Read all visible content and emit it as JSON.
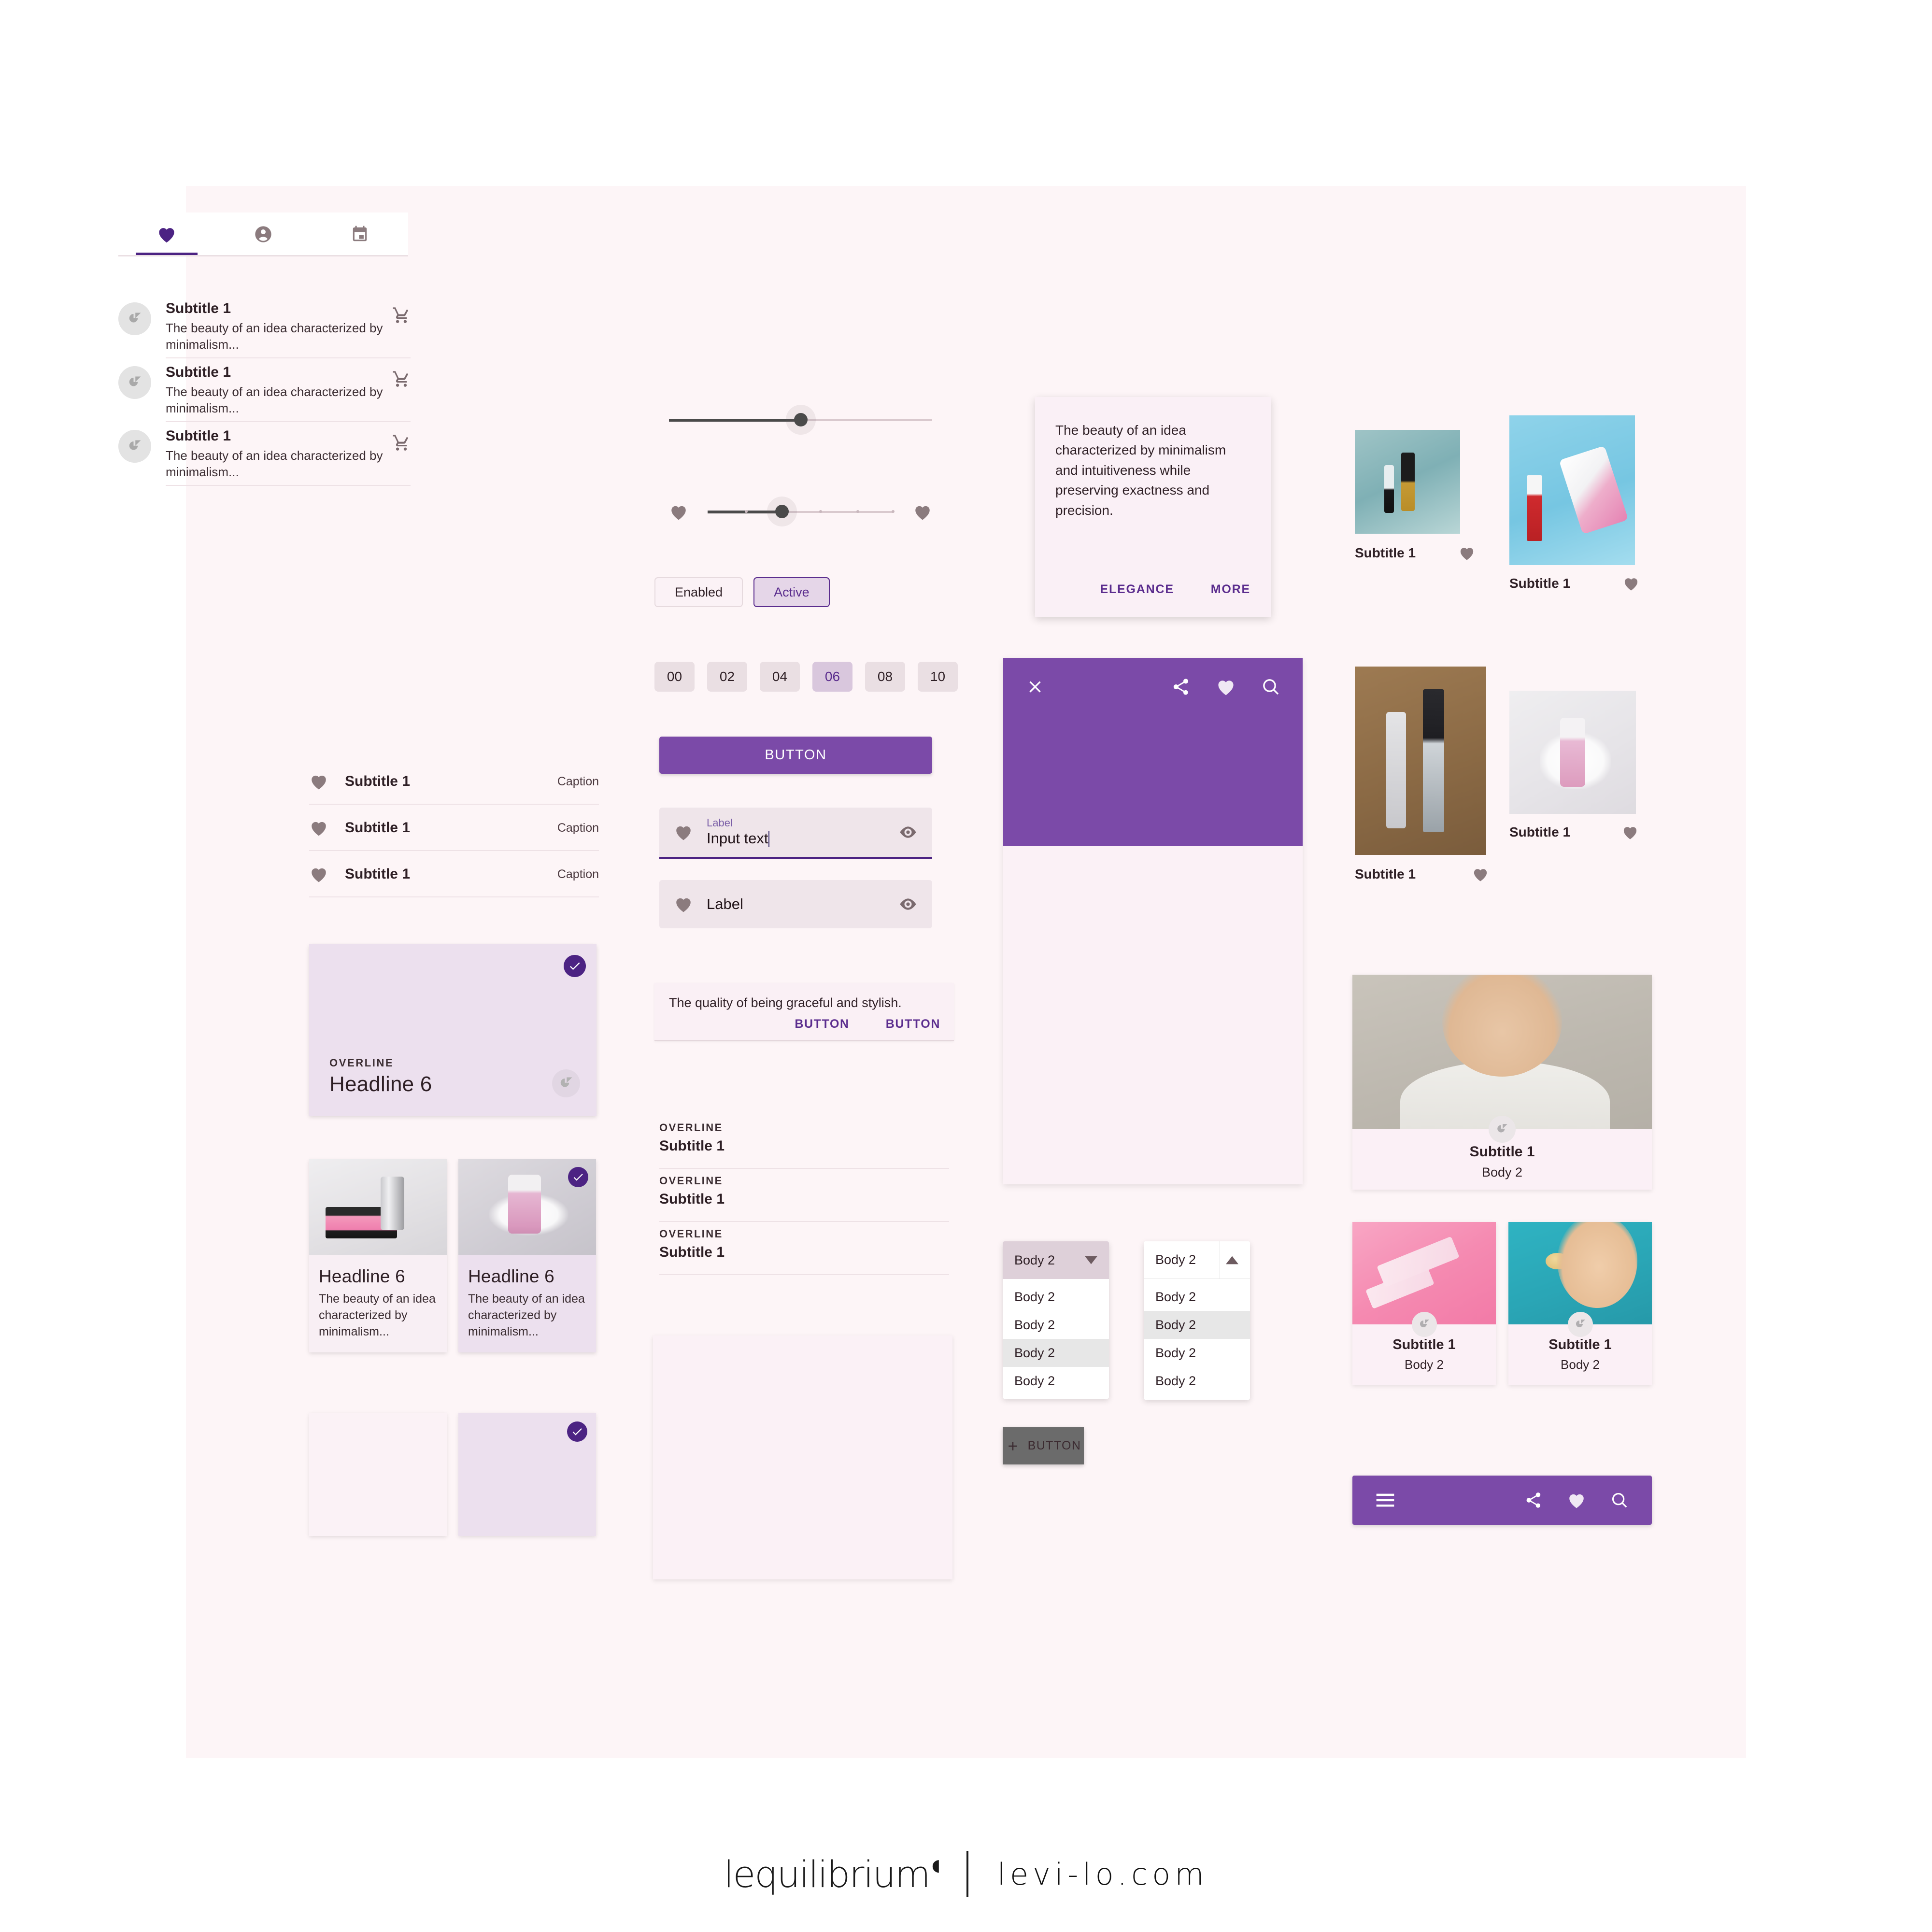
{
  "theme": {
    "canvas_bg": "#fdf5f7",
    "primary_purple": "#7b4aa8",
    "dark_purple": "#4c2383",
    "accent_text_purple": "#5b2d8e",
    "surface_lilac": "#ece0ee",
    "surface_pink": "#fbf1f6",
    "heart_grey": "#8b7b7e"
  },
  "tabs": [
    {
      "icon": "heart-icon",
      "active": true
    },
    {
      "icon": "account-circle-icon",
      "active": false
    },
    {
      "icon": "calendar-icon",
      "active": false
    }
  ],
  "avatar_list": {
    "items": [
      {
        "title": "Subtitle 1",
        "body": "The beauty of an idea characterized by minimalism...",
        "avatar_icon": "brand-mark-icon",
        "action_icon": "shopping-cart-icon"
      },
      {
        "title": "Subtitle 1",
        "body": "The beauty of an idea characterized by minimalism...",
        "avatar_icon": "brand-mark-icon",
        "action_icon": "shopping-cart-icon"
      },
      {
        "title": "Subtitle 1",
        "body": "The beauty of an idea characterized by minimalism...",
        "avatar_icon": "brand-mark-icon",
        "action_icon": "shopping-cart-icon"
      }
    ]
  },
  "heart_list": {
    "items": [
      {
        "icon": "heart-icon",
        "label": "Subtitle 1",
        "caption": "Caption"
      },
      {
        "icon": "heart-icon",
        "label": "Subtitle 1",
        "caption": "Caption"
      },
      {
        "icon": "heart-icon",
        "label": "Subtitle 1",
        "caption": "Caption"
      }
    ]
  },
  "big_card": {
    "overline": "OVERLINE",
    "headline": "Headline 6",
    "selected": true,
    "check_icon": "check-circle-icon",
    "brand_icon": "brand-mark-icon"
  },
  "image_cards": [
    {
      "headline": "Headline 6",
      "body": "The beauty of an idea characterized by minimalism...",
      "photo": "lipstick-and-blush-compact-photo",
      "selected": false
    },
    {
      "headline": "Headline 6",
      "body": "The beauty of an idea characterized by minimalism...",
      "photo": "pink-cleansing-foam-bottle-photo",
      "selected": true
    }
  ],
  "small_cards": [
    {
      "selected": false
    },
    {
      "selected": true,
      "check_icon": "check-circle-icon"
    }
  ],
  "sliders": [
    {
      "name": "continuous-slider",
      "value_pct": 50,
      "ticks": false
    },
    {
      "name": "discrete-slider",
      "value_pct": 40,
      "ticks": true,
      "leading_icon": "heart-icon",
      "trailing_icon": "heart-icon"
    }
  ],
  "toggle_chips": [
    {
      "label": "Enabled",
      "active": false
    },
    {
      "label": "Active",
      "active": true
    }
  ],
  "number_chips": {
    "values": [
      "00",
      "02",
      "04",
      "06",
      "08",
      "10"
    ],
    "selected": "06"
  },
  "primary_button": {
    "label": "BUTTON"
  },
  "text_fields": [
    {
      "state": "focused",
      "label": "Label",
      "value": "Input text",
      "leading_icon": "heart-icon",
      "trailing_icon": "eye-icon"
    },
    {
      "state": "plain",
      "label": "Label",
      "value": "",
      "leading_icon": "heart-icon",
      "trailing_icon": "eye-icon"
    }
  ],
  "snackbar": {
    "message": "The quality of being graceful and stylish.",
    "buttons": [
      "BUTTON",
      "BUTTON"
    ]
  },
  "overline_list": {
    "items": [
      {
        "overline": "OVERLINE",
        "subtitle": "Subtitle 1"
      },
      {
        "overline": "OVERLINE",
        "subtitle": "Subtitle 1"
      },
      {
        "overline": "OVERLINE",
        "subtitle": "Subtitle 1"
      }
    ]
  },
  "dialog": {
    "text": "The beauty of an idea characterized by minimalism and intuitiveness while preserving exactness and precision.",
    "buttons": [
      "ELEGANCE",
      "MORE"
    ]
  },
  "app_sheet": {
    "close_icon": "close-icon",
    "actions": [
      "share-icon",
      "heart-icon",
      "search-icon"
    ]
  },
  "dropdowns": [
    {
      "name": "dropdown-closed-style",
      "selected": "Body 2",
      "arrow_icon": "chevron-down-icon",
      "options": [
        "Body 2",
        "Body 2",
        "Body 2",
        "Body 2"
      ],
      "highlighted_index": 2
    },
    {
      "name": "dropdown-open-style",
      "selected": "Body 2",
      "arrow_icon": "chevron-up-icon",
      "options": [
        "Body 2",
        "Body 2",
        "Body 2",
        "Body 2"
      ],
      "highlighted_index": 1
    }
  ],
  "extended_fab": {
    "icon": "plus-icon",
    "label": "BUTTON"
  },
  "product_grid": [
    {
      "title": "Subtitle 1",
      "photo": "teal-lipgloss-photo",
      "fav_icon": "heart-icon"
    },
    {
      "title": "Subtitle 1",
      "photo": "blue-lipstick-set-photo",
      "fav_icon": "heart-icon"
    },
    {
      "title": "Subtitle 1",
      "photo": "gold-serum-bottles-photo",
      "fav_icon": "heart-icon"
    },
    {
      "title": "Subtitle 1",
      "photo": "pink-foam-bottle-photo",
      "fav_icon": "heart-icon"
    }
  ],
  "feature_card": {
    "title": "Subtitle 1",
    "body": "Body 2",
    "photo": "model-shoulder-portrait-photo",
    "mark_icon": "brand-mark-icon"
  },
  "duo_cards": [
    {
      "title": "Subtitle 1",
      "body": "Body 2",
      "photo": "pink-skincare-boxes-photo",
      "mark_icon": "brand-mark-icon"
    },
    {
      "title": "Subtitle 1",
      "body": "Body 2",
      "photo": "face-roller-model-photo",
      "mark_icon": "brand-mark-icon"
    }
  ],
  "bottom_bar": {
    "menu_icon": "hamburger-menu-icon",
    "actions": [
      "share-icon",
      "heart-icon",
      "search-icon"
    ]
  },
  "footer": {
    "brand_name": "lequilibrium",
    "brand_superscript": "◖",
    "website": "levi-lo.com"
  }
}
